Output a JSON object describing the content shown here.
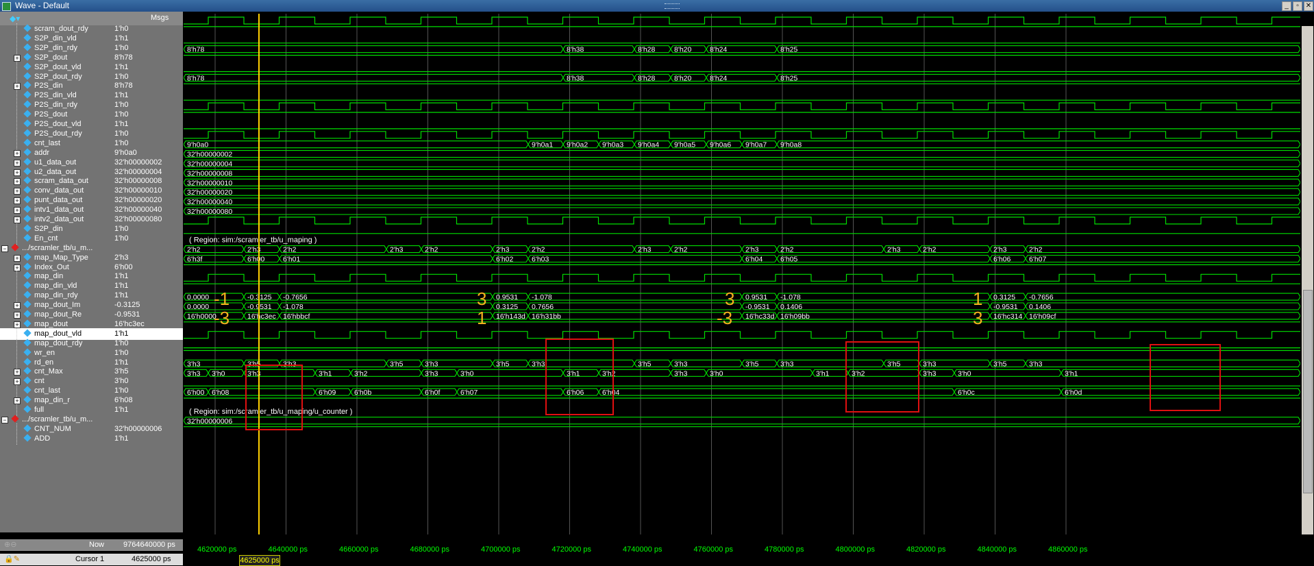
{
  "window": {
    "title": "Wave - Default",
    "controls": [
      "_",
      "▫",
      "✕"
    ]
  },
  "header": {
    "msgs_label": "Msgs"
  },
  "signals": [
    {
      "name": "scram_dout_rdy",
      "value": "1'h0",
      "indent": 1,
      "kind": "bit"
    },
    {
      "name": "S2P_din_vld",
      "value": "1'h1",
      "indent": 1,
      "kind": "bit"
    },
    {
      "name": "S2P_din_rdy",
      "value": "1'h0",
      "indent": 1,
      "kind": "bit"
    },
    {
      "name": "S2P_dout",
      "value": "8'h78",
      "indent": 1,
      "kind": "bus"
    },
    {
      "name": "S2P_dout_vld",
      "value": "1'h1",
      "indent": 1,
      "kind": "bit"
    },
    {
      "name": "S2P_dout_rdy",
      "value": "1'h0",
      "indent": 1,
      "kind": "bit"
    },
    {
      "name": "P2S_din",
      "value": "8'h78",
      "indent": 1,
      "kind": "bus"
    },
    {
      "name": "P2S_din_vld",
      "value": "1'h1",
      "indent": 1,
      "kind": "bit"
    },
    {
      "name": "P2S_din_rdy",
      "value": "1'h0",
      "indent": 1,
      "kind": "bit"
    },
    {
      "name": "P2S_dout",
      "value": "1'h0",
      "indent": 1,
      "kind": "bit"
    },
    {
      "name": "P2S_dout_vld",
      "value": "1'h1",
      "indent": 1,
      "kind": "bit"
    },
    {
      "name": "P2S_dout_rdy",
      "value": "1'h0",
      "indent": 1,
      "kind": "bit"
    },
    {
      "name": "cnt_last",
      "value": "1'h0",
      "indent": 1,
      "kind": "bit"
    },
    {
      "name": "addr",
      "value": "9'h0a0",
      "indent": 1,
      "kind": "bus"
    },
    {
      "name": "u1_data_out",
      "value": "32'h00000002",
      "indent": 1,
      "kind": "bus"
    },
    {
      "name": "u2_data_out",
      "value": "32'h00000004",
      "indent": 1,
      "kind": "bus"
    },
    {
      "name": "scram_data_out",
      "value": "32'h00000008",
      "indent": 1,
      "kind": "bus"
    },
    {
      "name": "conv_data_out",
      "value": "32'h00000010",
      "indent": 1,
      "kind": "bus"
    },
    {
      "name": "punt_data_out",
      "value": "32'h00000020",
      "indent": 1,
      "kind": "bus"
    },
    {
      "name": "intv1_data_out",
      "value": "32'h00000040",
      "indent": 1,
      "kind": "bus"
    },
    {
      "name": "intv2_data_out",
      "value": "32'h00000080",
      "indent": 1,
      "kind": "bus"
    },
    {
      "name": "S2P_din",
      "value": "1'h0",
      "indent": 1,
      "kind": "bit"
    },
    {
      "name": "En_cnt",
      "value": "1'h0",
      "indent": 1,
      "kind": "bit"
    },
    {
      "name": ".../scramler_tb/u_m...",
      "value": "",
      "indent": 0,
      "kind": "group"
    },
    {
      "name": "map_Map_Type",
      "value": "2'h3",
      "indent": 1,
      "kind": "bus"
    },
    {
      "name": "Index_Out",
      "value": "6'h00",
      "indent": 1,
      "kind": "bus"
    },
    {
      "name": "map_din",
      "value": "1'h1",
      "indent": 1,
      "kind": "bit"
    },
    {
      "name": "map_din_vld",
      "value": "1'h1",
      "indent": 1,
      "kind": "bit"
    },
    {
      "name": "map_din_rdy",
      "value": "1'h1",
      "indent": 1,
      "kind": "bit"
    },
    {
      "name": "map_dout_Im",
      "value": "-0.3125",
      "indent": 1,
      "kind": "bus"
    },
    {
      "name": "map_dout_Re",
      "value": "-0.9531",
      "indent": 1,
      "kind": "bus"
    },
    {
      "name": "map_dout",
      "value": "16'hc3ec",
      "indent": 1,
      "kind": "bus"
    },
    {
      "name": "map_dout_vld",
      "value": "1'h1",
      "indent": 1,
      "kind": "bit",
      "selected": true
    },
    {
      "name": "map_dout_rdy",
      "value": "1'h0",
      "indent": 1,
      "kind": "bit"
    },
    {
      "name": "wr_en",
      "value": "1'h0",
      "indent": 1,
      "kind": "bit"
    },
    {
      "name": "rd_en",
      "value": "1'h1",
      "indent": 1,
      "kind": "bit"
    },
    {
      "name": "cnt_Max",
      "value": "3'h5",
      "indent": 1,
      "kind": "bus"
    },
    {
      "name": "cnt",
      "value": "3'h0",
      "indent": 1,
      "kind": "bus"
    },
    {
      "name": "cnt_last",
      "value": "1'h0",
      "indent": 1,
      "kind": "bit"
    },
    {
      "name": "map_din_r",
      "value": "6'h08",
      "indent": 1,
      "kind": "bus"
    },
    {
      "name": "full",
      "value": "1'h1",
      "indent": 1,
      "kind": "bit"
    },
    {
      "name": ".../scramler_tb/u_m...",
      "value": "",
      "indent": 0,
      "kind": "group"
    },
    {
      "name": "CNT_NUM",
      "value": "32'h00000006",
      "indent": 1,
      "kind": "bit"
    },
    {
      "name": "ADD",
      "value": "1'h1",
      "indent": 1,
      "kind": "bit"
    }
  ],
  "buses": [
    {
      "row": 3,
      "segs": [
        [
          0,
          "8'h78"
        ],
        [
          554,
          "8'h38"
        ],
        [
          658,
          "8'h28"
        ],
        [
          711,
          "8'h20"
        ],
        [
          763,
          "8'h24"
        ],
        [
          866,
          "8'h25"
        ]
      ]
    },
    {
      "row": 6,
      "segs": [
        [
          0,
          "8'h78"
        ],
        [
          554,
          "8'h38"
        ],
        [
          658,
          "8'h28"
        ],
        [
          711,
          "8'h20"
        ],
        [
          763,
          "8'h24"
        ],
        [
          866,
          "8'h25"
        ]
      ]
    },
    {
      "row": 13,
      "segs": [
        [
          0,
          "9'h0a0"
        ],
        [
          503,
          "9'h0a1"
        ],
        [
          554,
          "9'h0a2"
        ],
        [
          606,
          "9'h0a3"
        ],
        [
          658,
          "9'h0a4"
        ],
        [
          711,
          "9'h0a5"
        ],
        [
          763,
          "9'h0a6"
        ],
        [
          815,
          "9'h0a7"
        ],
        [
          866,
          "9'h0a8"
        ]
      ]
    },
    {
      "row": 14,
      "segs": [
        [
          0,
          "32'h00000002"
        ]
      ]
    },
    {
      "row": 15,
      "segs": [
        [
          0,
          "32'h00000004"
        ]
      ]
    },
    {
      "row": 16,
      "segs": [
        [
          0,
          "32'h00000008"
        ]
      ]
    },
    {
      "row": 17,
      "segs": [
        [
          0,
          "32'h00000010"
        ]
      ]
    },
    {
      "row": 18,
      "segs": [
        [
          0,
          "32'h00000020"
        ]
      ]
    },
    {
      "row": 19,
      "segs": [
        [
          0,
          "32'h00000040"
        ]
      ]
    },
    {
      "row": 20,
      "segs": [
        [
          0,
          "32'h00000080"
        ]
      ]
    },
    {
      "row": 23,
      "segs": [
        [
          0,
          "( Region: sim:/scramler_tb/u_maping )"
        ]
      ],
      "text": true
    },
    {
      "row": 24,
      "segs": [
        [
          0,
          "2'h2"
        ],
        [
          88,
          "2'h3"
        ],
        [
          140,
          "2'h2"
        ],
        [
          296,
          "2'h3"
        ],
        [
          347,
          "2'h2"
        ],
        [
          451,
          "2'h3"
        ],
        [
          503,
          "2'h2"
        ],
        [
          658,
          "2'h3"
        ],
        [
          711,
          "2'h2"
        ],
        [
          815,
          "2'h3"
        ],
        [
          866,
          "2'h2"
        ],
        [
          1022,
          "2'h3"
        ],
        [
          1074,
          "2'h2"
        ],
        [
          1177,
          "2'h3"
        ],
        [
          1229,
          "2'h2"
        ]
      ]
    },
    {
      "row": 25,
      "segs": [
        [
          0,
          "6'h3f"
        ],
        [
          88,
          "6'h00"
        ],
        [
          140,
          "6'h01"
        ],
        [
          451,
          "6'h02"
        ],
        [
          503,
          "6'h03"
        ],
        [
          815,
          "6'h04"
        ],
        [
          866,
          "6'h05"
        ],
        [
          1177,
          "6'h06"
        ],
        [
          1229,
          "6'h07"
        ]
      ]
    },
    {
      "row": 29,
      "segs": [
        [
          0,
          "0.0000"
        ],
        [
          88,
          "-0.3125"
        ],
        [
          140,
          "-0.7656"
        ],
        [
          451,
          "0.9531"
        ],
        [
          503,
          "-1.078"
        ],
        [
          815,
          "0.9531"
        ],
        [
          866,
          "-1.078"
        ],
        [
          1177,
          "0.3125"
        ],
        [
          1229,
          "-0.7656"
        ]
      ]
    },
    {
      "row": 30,
      "segs": [
        [
          0,
          "0.0000"
        ],
        [
          88,
          "-0.9531"
        ],
        [
          140,
          "-1.078"
        ],
        [
          451,
          "0.3125"
        ],
        [
          503,
          "0.7656"
        ],
        [
          815,
          "-0.9531"
        ],
        [
          866,
          "0.1406"
        ],
        [
          1177,
          "-0.9531"
        ],
        [
          1229,
          "0.1406"
        ]
      ]
    },
    {
      "row": 31,
      "segs": [
        [
          0,
          "16'h0000"
        ],
        [
          88,
          "16'hc3ec"
        ],
        [
          140,
          "16'hbbcf"
        ],
        [
          451,
          "16'h143d"
        ],
        [
          503,
          "16'h31bb"
        ],
        [
          815,
          "16'hc33d"
        ],
        [
          866,
          "16'h09bb"
        ],
        [
          1177,
          "16'hc314"
        ],
        [
          1229,
          "16'h09cf"
        ]
      ]
    },
    {
      "row": 36,
      "segs": [
        [
          0,
          "3'h3"
        ],
        [
          88,
          "3'h5"
        ],
        [
          140,
          "3'h3"
        ],
        [
          296,
          "3'h5"
        ],
        [
          347,
          "3'h3"
        ],
        [
          451,
          "3'h5"
        ],
        [
          503,
          "3'h3"
        ],
        [
          658,
          "3'h5"
        ],
        [
          711,
          "3'h3"
        ],
        [
          815,
          "3'h5"
        ],
        [
          866,
          "3'h3"
        ],
        [
          1022,
          "3'h5"
        ],
        [
          1074,
          "3'h3"
        ],
        [
          1177,
          "3'h5"
        ],
        [
          1229,
          "3'h3"
        ]
      ]
    },
    {
      "row": 37,
      "segs": [
        [
          0,
          "3'h3"
        ],
        [
          36,
          "3'h0"
        ],
        [
          88,
          "3'h3"
        ],
        [
          192,
          "3'h1"
        ],
        [
          244,
          "3'h2"
        ],
        [
          347,
          "3'h3"
        ],
        [
          399,
          "3'h0"
        ],
        [
          554,
          "3'h1"
        ],
        [
          606,
          "3'h2"
        ],
        [
          711,
          "3'h3"
        ],
        [
          763,
          "3'h0"
        ],
        [
          918,
          "3'h1"
        ],
        [
          970,
          "3'h2"
        ],
        [
          1074,
          "3'h3"
        ],
        [
          1125,
          "3'h0"
        ],
        [
          1281,
          "3'h1"
        ]
      ]
    },
    {
      "row": 39,
      "segs": [
        [
          0,
          "6'h00"
        ],
        [
          36,
          "6'h08"
        ],
        [
          192,
          "6'h09"
        ],
        [
          244,
          "6'h0b"
        ],
        [
          347,
          "6'h0f"
        ],
        [
          399,
          "6'h07"
        ],
        [
          554,
          "6'h06"
        ],
        [
          606,
          "6'h04"
        ],
        [
          1125,
          "6'h0c"
        ],
        [
          1281,
          "6'h0d"
        ]
      ]
    },
    {
      "row": 41,
      "segs": [
        [
          0,
          "( Region: sim:/scramler_tb/u_maping/u_counter )"
        ]
      ],
      "text": true
    },
    {
      "row": 42,
      "segs": [
        [
          0,
          "32'h00000006"
        ]
      ]
    }
  ],
  "annotations": [
    {
      "text": "-1",
      "row": 29,
      "at": 52
    },
    {
      "text": "-3",
      "row": 31,
      "at": 52
    },
    {
      "text": "3",
      "row": 29,
      "at": 428
    },
    {
      "text": "1",
      "row": 31,
      "at": 428
    },
    {
      "text": "3",
      "row": 29,
      "at": 790
    },
    {
      "text": "-3",
      "row": 31,
      "at": 786
    },
    {
      "text": "1",
      "row": 29,
      "at": 1152
    },
    {
      "text": "3",
      "row": 31,
      "at": 1152
    }
  ],
  "status": {
    "now_label": "Now",
    "now_value": "9764640000 ps",
    "cursor_label": "Cursor 1",
    "cursor_value": "4625000 ps",
    "cursor_marker": "4625000 ps"
  },
  "time_ticks": [
    "4620000 ps",
    "4640000 ps",
    "4660000 ps",
    "4680000 ps",
    "4700000 ps",
    "4720000 ps",
    "4740000 ps",
    "4760000 ps",
    "4780000 ps",
    "4800000 ps",
    "4820000 ps",
    "4840000 ps",
    "4860000 ps"
  ],
  "colors": {
    "wave": "#00e000",
    "cursor": "#ffd000",
    "box": "#e01010",
    "annotation": "#f4b020"
  }
}
